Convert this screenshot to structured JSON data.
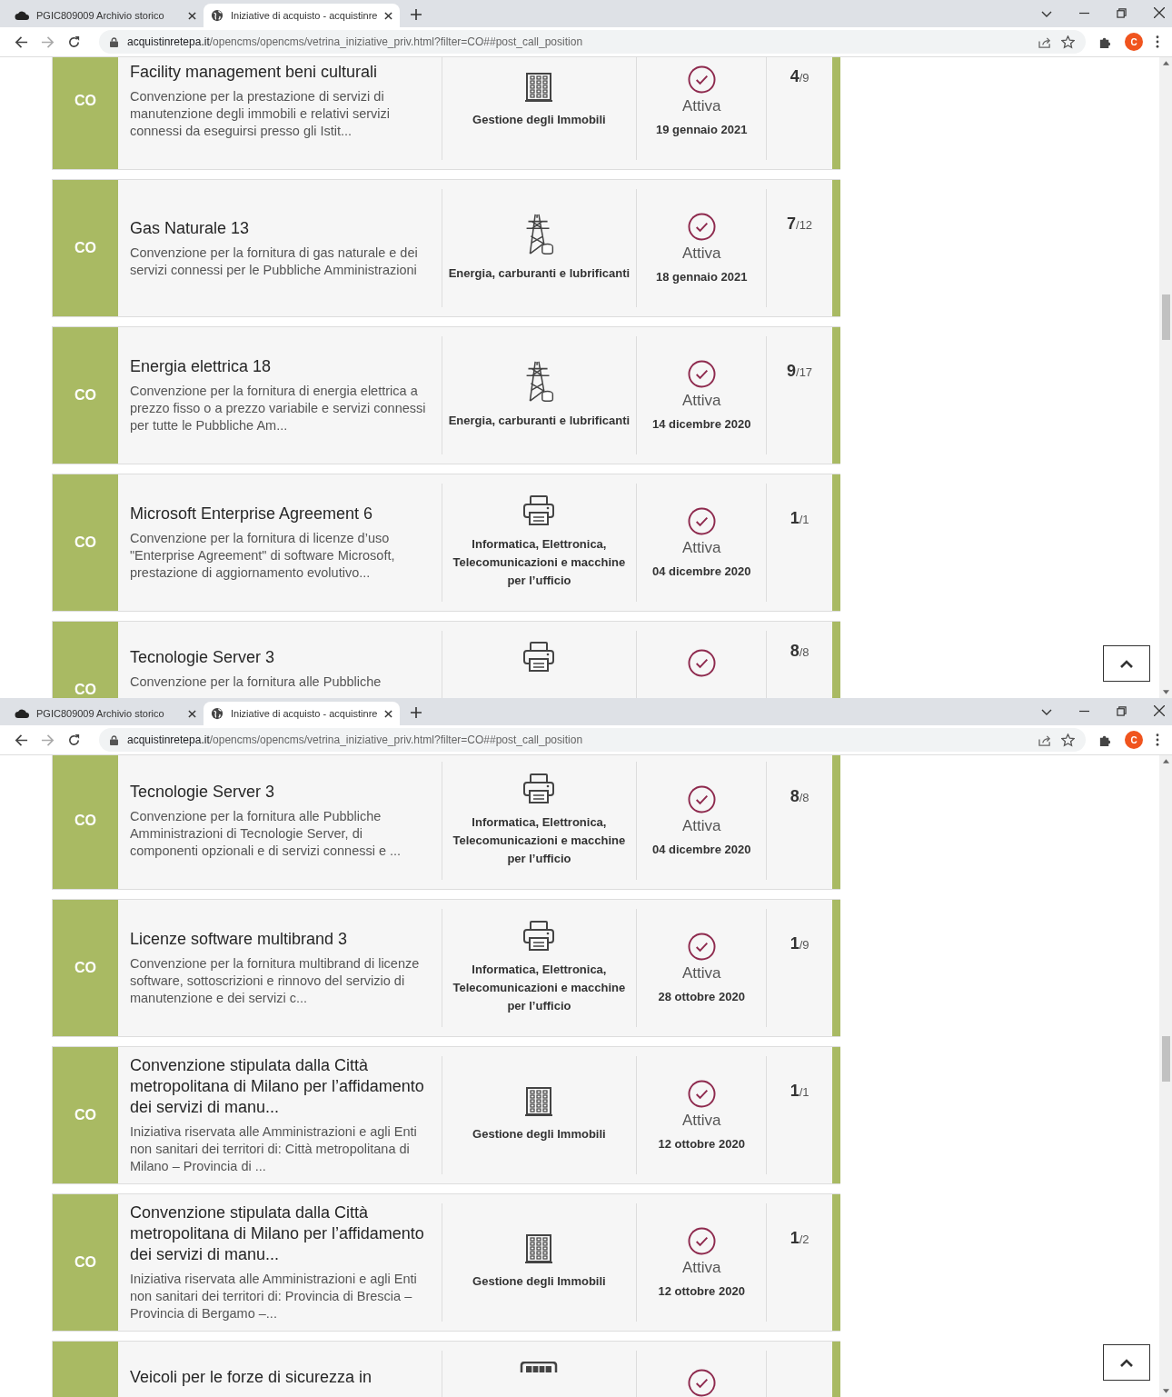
{
  "windows": [
    {
      "tabs": [
        {
          "label": "PGIC809009 Archivio storico",
          "selected": false
        },
        {
          "label": "Iniziative di acquisto - acquistinre",
          "selected": true
        }
      ],
      "address": {
        "host": "acquistinretepa.it",
        "path": "/opencms/opencms/vetrina_iniziative_priv.html?filter=CO##post_call_position"
      },
      "profile_initial": "C",
      "cards": [
        {
          "type": "CO",
          "title": "Facility management beni culturali",
          "description": "Convenzione per la prestazione di servizi di manutenzione degli immobili e relativi servizi connessi da eseguirsi presso gli Istit...",
          "kind": "building",
          "category": "Gestione degli Immobili",
          "status": "Attiva",
          "date": "19 gennaio 2021",
          "count": "4",
          "total": "/9"
        },
        {
          "type": "CO",
          "title": "Gas Naturale 13",
          "description": "Convenzione per la fornitura di gas naturale e dei servizi connessi per le Pubbliche Amministrazioni",
          "kind": "tower",
          "category": "Energia, carburanti e lubrificanti",
          "status": "Attiva",
          "date": "18 gennaio 2021",
          "count": "7",
          "total": "/12"
        },
        {
          "type": "CO",
          "title": "Energia elettrica 18",
          "description": "Convenzione per la fornitura di energia elettrica a prezzo fisso o a prezzo variabile e servizi connessi per tutte le Pubbliche Am...",
          "kind": "tower",
          "category": "Energia, carburanti e lubrificanti",
          "status": "Attiva",
          "date": "14 dicembre 2020",
          "count": "9",
          "total": "/17"
        },
        {
          "type": "CO",
          "title": "Microsoft Enterprise Agreement 6",
          "description": "Convenzione per la fornitura di licenze d’uso \"Enterprise Agreement\" di software Microsoft, prestazione di aggiornamento evolutivo...",
          "kind": "printer",
          "category": "Informatica, Elettronica, Telecomunicazioni e macchine per l’ufficio",
          "status": "Attiva",
          "date": "04 dicembre 2020",
          "count": "1",
          "total": "/1"
        },
        {
          "type": "CO",
          "title": "Tecnologie Server 3",
          "description": "Convenzione per la fornitura alle Pubbliche",
          "kind": "printer",
          "count": "8",
          "total": "/8"
        }
      ]
    },
    {
      "tabs": [
        {
          "label": "PGIC809009 Archivio storico",
          "selected": false
        },
        {
          "label": "Iniziative di acquisto - acquistinre",
          "selected": true
        }
      ],
      "address": {
        "host": "acquistinretepa.it",
        "path": "/opencms/opencms/vetrina_iniziative_priv.html?filter=CO##post_call_position"
      },
      "profile_initial": "C",
      "cards": [
        {
          "type": "CO",
          "title": "Tecnologie Server 3",
          "description": "Convenzione per la fornitura alle Pubbliche Amministrazioni di Tecnologie Server, di componenti opzionali e di servizi connessi e ...",
          "kind": "printer",
          "category": "Informatica, Elettronica, Telecomunicazioni e macchine per l’ufficio",
          "status": "Attiva",
          "date": "04 dicembre 2020",
          "count": "8",
          "total": "/8"
        },
        {
          "type": "CO",
          "title": "Licenze software multibrand 3",
          "description": "Convenzione per la fornitura multibrand di licenze software, sottoscrizioni e rinnovo del servizio di manutenzione e dei servizi c...",
          "kind": "printer",
          "category": "Informatica, Elettronica, Telecomunicazioni e macchine per l’ufficio",
          "status": "Attiva",
          "date": "28 ottobre 2020",
          "count": "1",
          "total": "/9"
        },
        {
          "type": "CO",
          "title": "Convenzione stipulata dalla Città metropolitana di Milano per l’affidamento dei servizi di manu...",
          "description": "Iniziativa riservata alle Amministrazioni e agli Enti non sanitari dei territori di: Città metropolitana di Milano – Provincia di ...",
          "kind": "building",
          "category": "Gestione degli Immobili",
          "status": "Attiva",
          "date": "12 ottobre 2020",
          "count": "1",
          "total": "/1"
        },
        {
          "type": "CO",
          "title": "Convenzione stipulata dalla Città metropolitana di Milano per l’affidamento dei servizi di manu...",
          "description": "Iniziativa riservata alle Amministrazioni e agli Enti non sanitari dei territori di: Provincia di Brescia – Provincia di Bergamo –...",
          "kind": "building",
          "category": "Gestione degli Immobili",
          "status": "Attiva",
          "date": "12 ottobre 2020",
          "count": "1",
          "total": "/2"
        },
        {
          "title": "Veicoli per le forze di sicurezza in",
          "kind": "vehicle"
        }
      ]
    }
  ]
}
